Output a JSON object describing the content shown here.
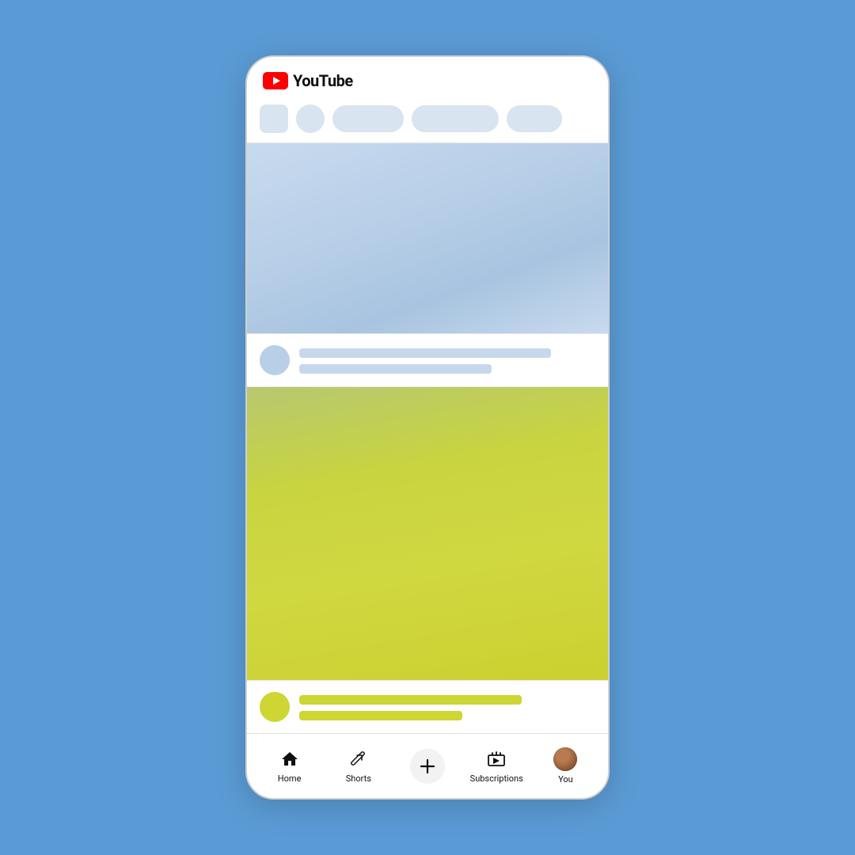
{
  "app": {
    "name": "YouTube",
    "logo_text": "YouTube"
  },
  "header": {
    "title": "YouTube"
  },
  "filter_chips": [
    {
      "type": "square"
    },
    {
      "type": "circle"
    },
    {
      "type": "pill",
      "size": "medium"
    },
    {
      "type": "pill",
      "size": "large"
    },
    {
      "type": "pill",
      "size": "small"
    }
  ],
  "bottom_nav": {
    "items": [
      {
        "id": "home",
        "label": "Home",
        "icon": "home-icon"
      },
      {
        "id": "shorts",
        "label": "Shorts",
        "icon": "shorts-icon"
      },
      {
        "id": "add",
        "label": "",
        "icon": "add-icon"
      },
      {
        "id": "subscriptions",
        "label": "Subscriptions",
        "icon": "subscriptions-icon"
      },
      {
        "id": "you",
        "label": "You",
        "icon": "user-avatar-icon"
      }
    ]
  }
}
